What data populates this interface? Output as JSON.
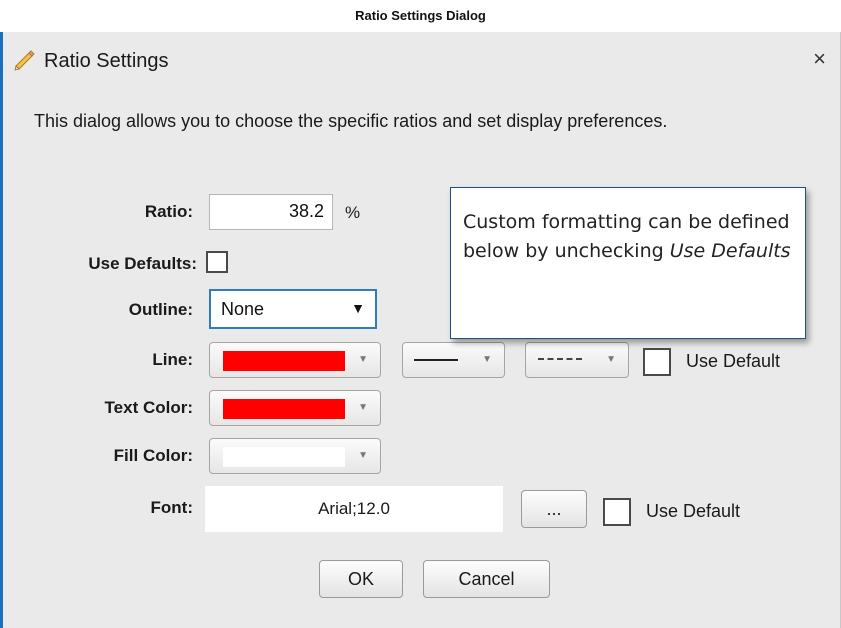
{
  "caption": "Ratio Settings Dialog",
  "dialog": {
    "title": "Ratio Settings",
    "close_label": "×",
    "description": "This dialog allows you to choose the specific ratios and set display preferences.",
    "tooltip": {
      "text": "Custom formatting can be defined below by unchecking ",
      "emphasis": "Use Defaults"
    },
    "ratio": {
      "label": "Ratio:",
      "value": "38.2",
      "unit": "%"
    },
    "use_defaults": {
      "label": "Use Defaults:",
      "checked": false
    },
    "outline": {
      "label": "Outline:",
      "value": "None"
    },
    "line": {
      "label": "Line:",
      "color": "#ff0000",
      "use_default_label": "Use Default"
    },
    "text_color": {
      "label": "Text Color:",
      "color": "#ff0000"
    },
    "fill_color": {
      "label": "Fill Color:",
      "color": "#ffffff"
    },
    "font": {
      "label": "Font:",
      "value": "Arial;12.0",
      "browse_label": "...",
      "use_default_label": "Use Default"
    },
    "buttons": {
      "ok": "OK",
      "cancel": "Cancel"
    }
  }
}
